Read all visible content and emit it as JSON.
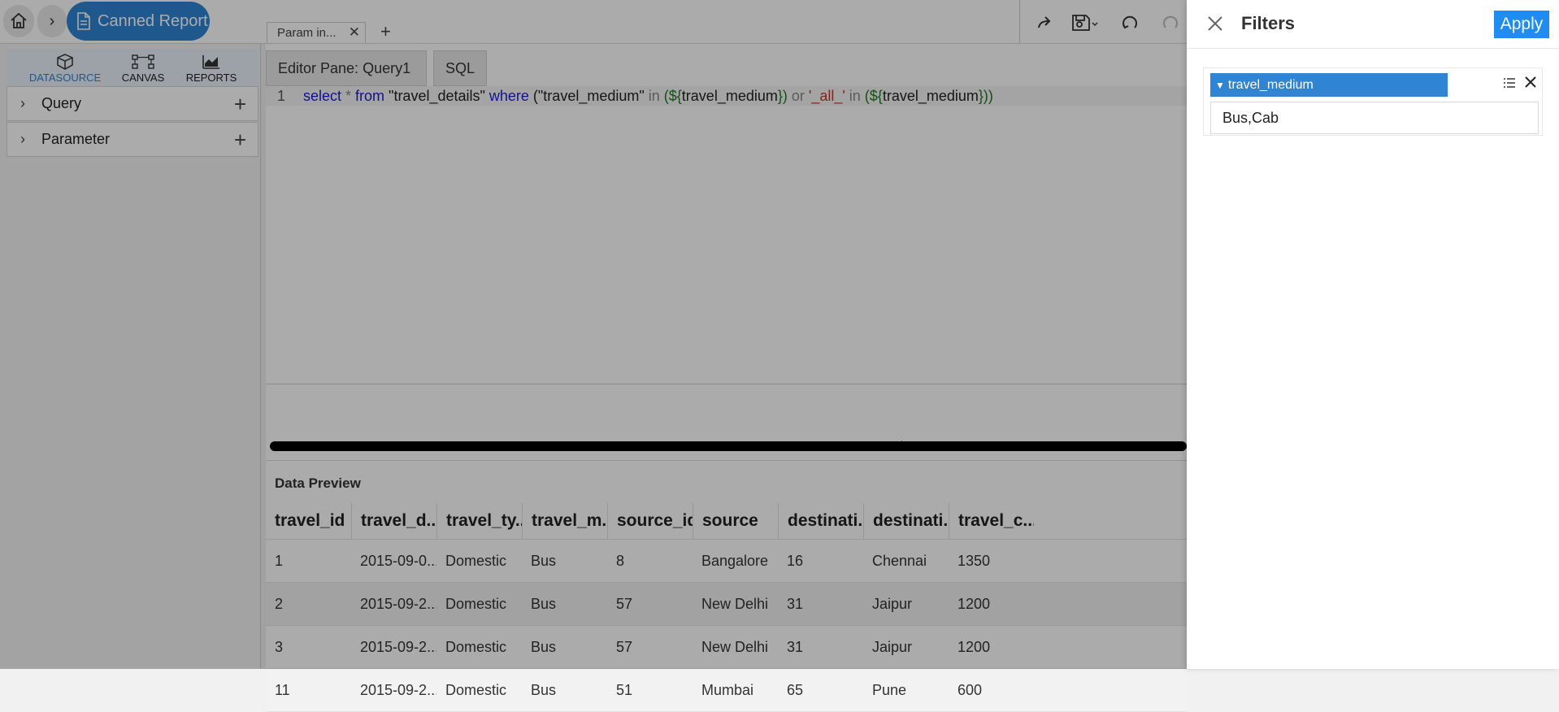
{
  "topbar": {
    "report_label": "Canned Report",
    "doc_tab_label": "Param in...",
    "add_tab": "+"
  },
  "left_panel": {
    "tabs": [
      {
        "label": "DATASOURCE",
        "icon": "cube-icon",
        "active": true
      },
      {
        "label": "CANVAS",
        "icon": "canvas-icon",
        "active": false
      },
      {
        "label": "REPORTS",
        "icon": "chart-icon",
        "active": false
      }
    ],
    "sections": [
      {
        "label": "Query"
      },
      {
        "label": "Parameter"
      }
    ]
  },
  "editor": {
    "pane_tabs": [
      "Editor Pane: Query1",
      "SQL"
    ],
    "line_number": "1",
    "sql": {
      "t1": "select",
      "t2": " * ",
      "t3": "from",
      "t4": " \"travel_details\" ",
      "t5": "where",
      "t6": " (\"travel_medium\" ",
      "t7": "in",
      "t8": " (${",
      "t9": "travel_medium",
      "t10": "}) ",
      "t11": "or",
      "t12": " '_all_' ",
      "t13": "in",
      "t14": " (${",
      "t15": "travel_medium",
      "t16": "}))"
    }
  },
  "preview": {
    "title": "Data Preview",
    "columns": [
      "travel_id",
      "travel_d...",
      "travel_ty...",
      "travel_m...",
      "source_id",
      "source",
      "destinati...",
      "destinati...",
      "travel_c..."
    ],
    "rows": [
      [
        "1",
        "2015-09-0...",
        "Domestic",
        "Bus",
        "8",
        "Bangalore",
        "16",
        "Chennai",
        "1350"
      ],
      [
        "2",
        "2015-09-2...",
        "Domestic",
        "Bus",
        "57",
        "New Delhi",
        "31",
        "Jaipur",
        "1200"
      ],
      [
        "3",
        "2015-09-2...",
        "Domestic",
        "Bus",
        "57",
        "New Delhi",
        "31",
        "Jaipur",
        "1200"
      ],
      [
        "11",
        "2015-09-2...",
        "Domestic",
        "Bus",
        "51",
        "Mumbai",
        "65",
        "Pune",
        "600"
      ]
    ]
  },
  "filters": {
    "title": "Filters",
    "apply_label": "Apply",
    "filter_name": "travel_medium",
    "filter_value": "Bus,Cab"
  },
  "colors": {
    "accent": "#2f84d3",
    "apply": "#1e8cf0"
  }
}
